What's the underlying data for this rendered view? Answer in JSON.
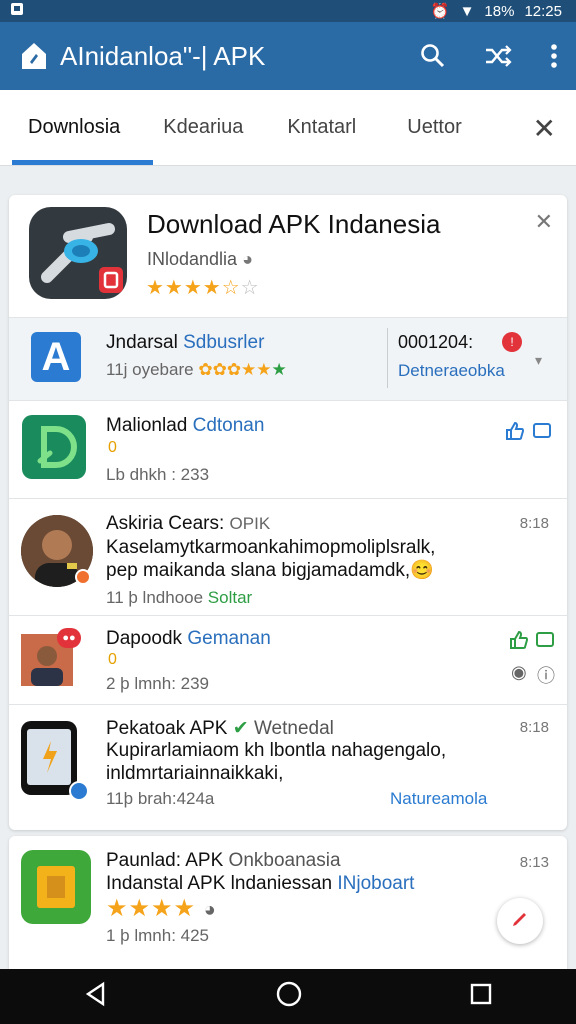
{
  "status_bar": {
    "time": "12:25",
    "battery": "18%"
  },
  "app_bar": {
    "title": "AInidanloa\"-| APK",
    "icons": [
      "app-logo-icon",
      "search-icon",
      "shuffle-icon",
      "more-vert-icon"
    ]
  },
  "tabs": [
    {
      "label": "Downlosia",
      "active": true
    },
    {
      "label": "Kdeariua",
      "active": false
    },
    {
      "label": "Kntatarl",
      "active": false
    },
    {
      "label": "Uettor",
      "active": false
    }
  ],
  "hero": {
    "title": "Download APK Indanesia",
    "subtitle": "INlodandlia",
    "rating_stars": 4.5
  },
  "items": [
    {
      "name": "Jndarsal",
      "tag": "Sdbusrler",
      "meta": "11j oyebare",
      "count": "0001204:",
      "action": "Detneraeobka"
    },
    {
      "name": "Malionlad",
      "tag": "Cdtonan",
      "emoji": "0",
      "meta": "Lb dhkh : 233"
    },
    {
      "name": "Askiria Cears:",
      "tag": "OPIK",
      "time": "8:18",
      "body_line1": "Kaselamytkarmoankahimopmoliplsralk,",
      "body_line2": "pep maikanda slana bigjamadamdk,",
      "meta": "11 þ lndhooe",
      "meta_tag": "Soltar"
    },
    {
      "name": "Dapoodk",
      "tag": "Gemanan",
      "emoji": "0",
      "meta": "2 þ lmnh: 239"
    },
    {
      "name": "Pekatoak APK",
      "tag": "Wetnedal",
      "time": "8:18",
      "body_line1": "Kupirarlamiaom kh lbontla nahagengalo,",
      "body_line2": "inldmrtariainnaikkaki,",
      "meta": "11þ brah:424a",
      "action": "Natureamola"
    },
    {
      "name": "Paunlad: APK",
      "tag": "Onkboanasia",
      "time": "8:13",
      "body_line1": "Indanstal APK",
      "body_line2": "lndaniessan",
      "body_tag": "INjoboart",
      "meta": "1 þ lmnh: 425",
      "rating_stars": 4
    }
  ],
  "colors": {
    "app_bar": "#2a6aa5",
    "accent": "#2a7bd1",
    "star": "#f5a31a"
  }
}
